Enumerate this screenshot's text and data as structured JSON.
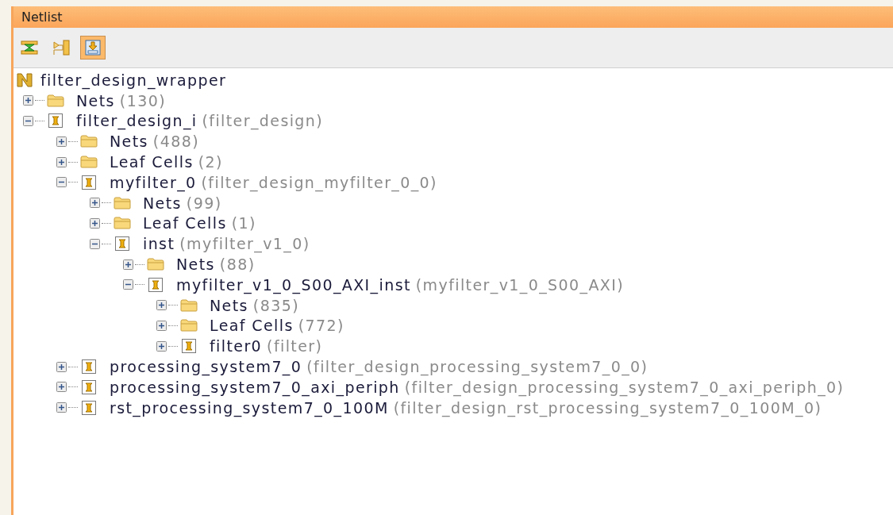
{
  "panel": {
    "title": "Netlist"
  },
  "toolbar": [
    {
      "kind": "collapse",
      "selected": false
    },
    {
      "kind": "schematic",
      "selected": false
    },
    {
      "kind": "autoexpand",
      "selected": true
    }
  ],
  "tree": {
    "label": "filter_design_wrapper",
    "kind": "netlist",
    "children": [
      {
        "label": "Nets",
        "detail": "(130)",
        "kind": "folder",
        "expanded": false
      },
      {
        "label": "filter_design_i",
        "detail": "(filter_design)",
        "kind": "cell",
        "expanded": true,
        "children": [
          {
            "label": "Nets",
            "detail": "(488)",
            "kind": "folder",
            "expanded": false
          },
          {
            "label": "Leaf Cells",
            "detail": "(2)",
            "kind": "folder",
            "expanded": false
          },
          {
            "label": "myfilter_0",
            "detail": "(filter_design_myfilter_0_0)",
            "kind": "cell",
            "expanded": true,
            "children": [
              {
                "label": "Nets",
                "detail": "(99)",
                "kind": "folder",
                "expanded": false
              },
              {
                "label": "Leaf Cells",
                "detail": "(1)",
                "kind": "folder",
                "expanded": false
              },
              {
                "label": "inst",
                "detail": "(myfilter_v1_0)",
                "kind": "cell",
                "expanded": true,
                "children": [
                  {
                    "label": "Nets",
                    "detail": "(88)",
                    "kind": "folder",
                    "expanded": false
                  },
                  {
                    "label": "myfilter_v1_0_S00_AXI_inst",
                    "detail": "(myfilter_v1_0_S00_AXI)",
                    "kind": "cell",
                    "expanded": true,
                    "children": [
                      {
                        "label": "Nets",
                        "detail": "(835)",
                        "kind": "folder",
                        "expanded": false
                      },
                      {
                        "label": "Leaf Cells",
                        "detail": "(772)",
                        "kind": "folder",
                        "expanded": false
                      },
                      {
                        "label": "filter0",
                        "detail": "(filter)",
                        "kind": "cell",
                        "expanded": false
                      }
                    ]
                  }
                ]
              }
            ]
          },
          {
            "label": "processing_system7_0",
            "detail": "(filter_design_processing_system7_0_0)",
            "kind": "cell",
            "expanded": false
          },
          {
            "label": "processing_system7_0_axi_periph",
            "detail": "(filter_design_processing_system7_0_axi_periph_0)",
            "kind": "cell",
            "expanded": false
          },
          {
            "label": "rst_processing_system7_0_100M",
            "detail": "(filter_design_rst_processing_system7_0_100M_0)",
            "kind": "cell",
            "expanded": false
          }
        ]
      }
    ]
  }
}
